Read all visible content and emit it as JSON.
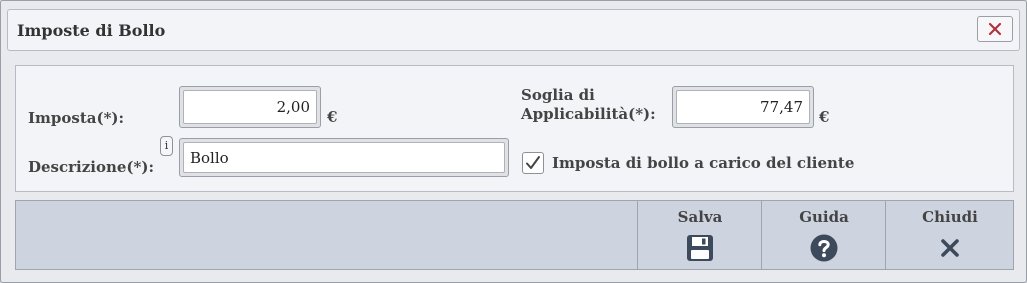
{
  "dialog": {
    "title": "Imposte di Bollo"
  },
  "form": {
    "imposta_label": "Imposta(*):",
    "imposta_value": "2,00",
    "imposta_currency": "€",
    "soglia_label_line1": "Soglia di",
    "soglia_label_line2": "Applicabilità(*):",
    "soglia_value": "77,47",
    "soglia_currency": "€",
    "descrizione_label": "Descrizione(*):",
    "descrizione_value": "Bollo",
    "info_badge": "i",
    "checkbox_label": "Imposta di bollo a carico del cliente",
    "checkbox_checked": true
  },
  "toolbar": {
    "buttons": [
      {
        "label": "Salva",
        "icon": "save-icon"
      },
      {
        "label": "Guida",
        "icon": "help-icon"
      },
      {
        "label": "Chiudi",
        "icon": "close-icon"
      }
    ]
  },
  "colors": {
    "close_x": "#b0323b",
    "icon_dark": "#3d4a5c",
    "toolbar_bg": "#ced4df"
  }
}
